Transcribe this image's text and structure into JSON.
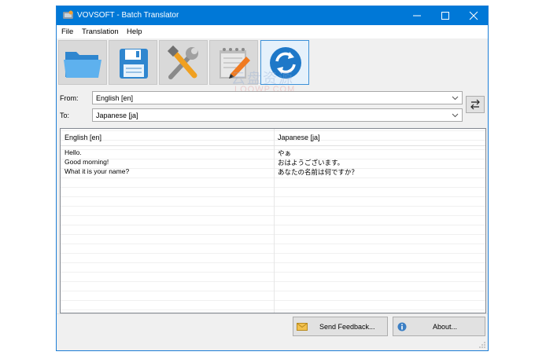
{
  "window": {
    "title": "VOVSOFT - Batch Translator"
  },
  "menu": [
    "File",
    "Translation",
    "Help"
  ],
  "toolbar": {
    "buttons": [
      {
        "name": "open-folder-icon"
      },
      {
        "name": "save-icon"
      },
      {
        "name": "tools-icon"
      },
      {
        "name": "notepad-edit-icon"
      },
      {
        "name": "refresh-translate-icon",
        "active": true
      }
    ]
  },
  "from": {
    "label": "From:",
    "value": "English [en]"
  },
  "to": {
    "label": "To:",
    "value": "Japanese [ja]"
  },
  "table": {
    "headers": [
      "English [en]",
      "Japanese [ja]"
    ],
    "rows": [
      [
        "Hello.",
        "やぁ"
      ],
      [
        "Good morning!",
        "おはようございます。"
      ],
      [
        "What it is your name?",
        "あなたの名前は何ですか？"
      ]
    ]
  },
  "footer": {
    "feedback": "Send Feedback...",
    "about": "About..."
  },
  "watermark": {
    "line1": "云盘资源",
    "line2": "LOOWP.COM"
  },
  "colors": {
    "titlebar": "#0078d7",
    "accent": "#3c91d8"
  }
}
